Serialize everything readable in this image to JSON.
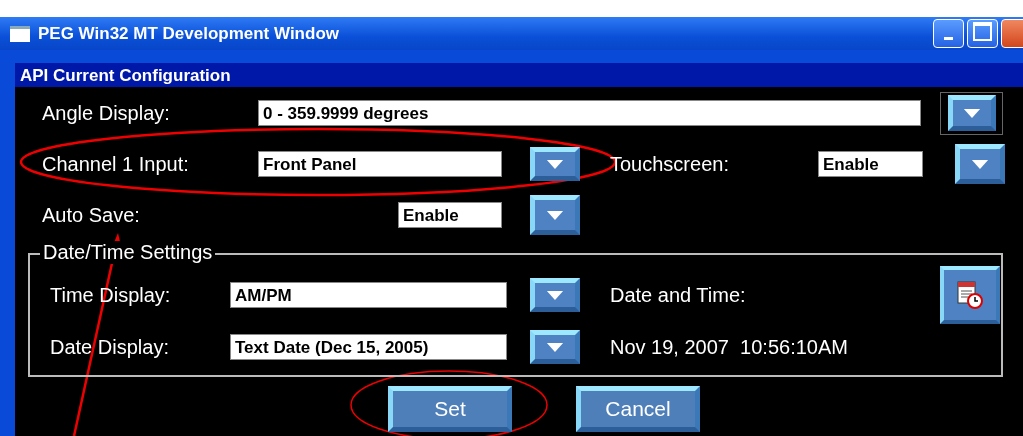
{
  "window": {
    "title": "PEG Win32 MT Development Window"
  },
  "panel": {
    "title": "API Current Configuration"
  },
  "angle_display": {
    "label": "Angle Display:",
    "value": "0 - 359.9999 degrees"
  },
  "channel_1_input": {
    "label": "Channel 1 Input:",
    "value": "Front Panel"
  },
  "touchscreen": {
    "label": "Touchscreen:",
    "value": "Enable"
  },
  "auto_save": {
    "label": "Auto Save:",
    "value": "Enable"
  },
  "datetime_group": {
    "title": "Date/Time Settings",
    "time_display": {
      "label": "Time Display:",
      "value": "AM/PM"
    },
    "date_display": {
      "label": "Date Display:",
      "value": "Text Date (Dec 15, 2005)"
    },
    "date_and_time_label": "Date and Time:",
    "date_and_time_value": "Nov 19, 2007  10:56:10AM"
  },
  "buttons": [
    "Set",
    "Cancel"
  ]
}
